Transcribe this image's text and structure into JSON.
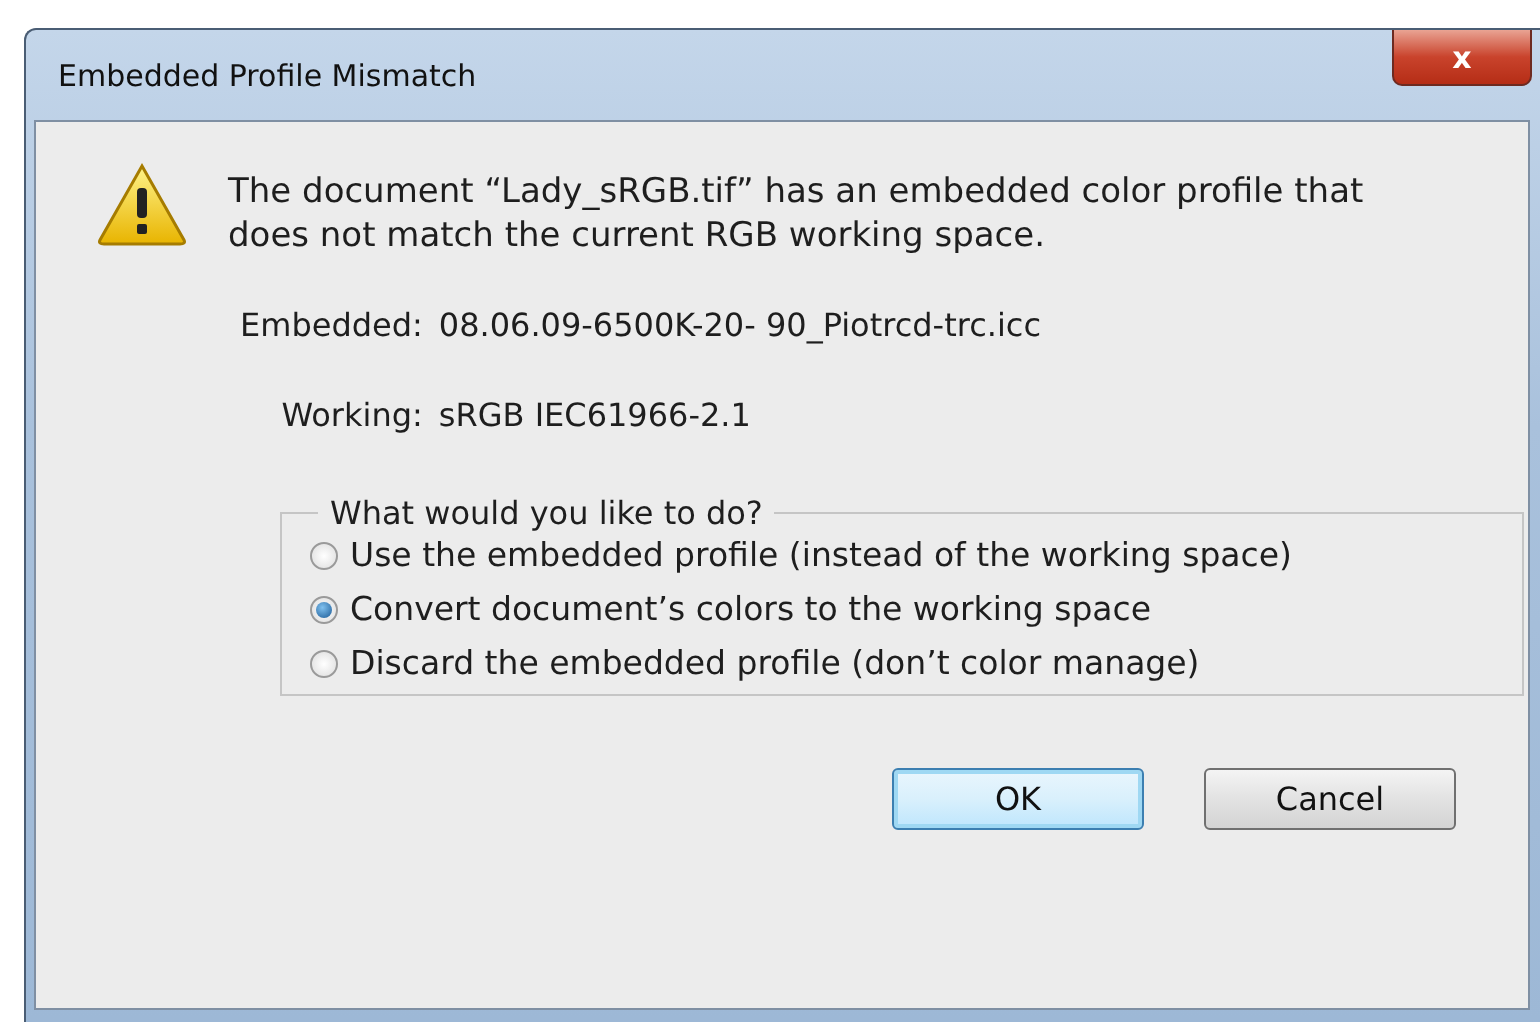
{
  "window": {
    "title": "Embedded Profile Mismatch",
    "close": "x"
  },
  "message": "The document “Lady_sRGB.tif” has an embedded color profile that does not match the current RGB working space.",
  "details": [
    {
      "label": "Embedded:",
      "value": "08.06.09-6500K-20- 90_Piotrcd-trc.icc"
    },
    {
      "label": "Working:",
      "value": "sRGB IEC61966-2.1"
    }
  ],
  "group": {
    "legend": "What would you like to do?",
    "options": [
      {
        "label": "Use the embedded profile (instead of the working space)",
        "selected": false
      },
      {
        "label": "Convert document’s colors to the working space",
        "selected": true
      },
      {
        "label": "Discard the embedded profile (don’t color manage)",
        "selected": false
      }
    ]
  },
  "buttons": [
    {
      "label": "OK",
      "kind": "default"
    },
    {
      "label": "Cancel",
      "kind": "normal"
    }
  ]
}
